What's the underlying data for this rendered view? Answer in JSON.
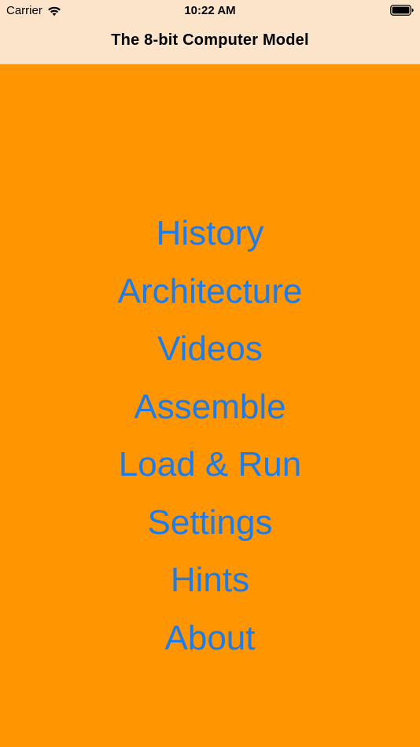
{
  "status_bar": {
    "carrier": "Carrier",
    "time": "10:22 AM",
    "wifi_icon": "wifi-icon",
    "battery_icon": "battery-icon"
  },
  "nav": {
    "title": "The 8-bit Computer Model"
  },
  "menu": {
    "items": [
      {
        "label": "History"
      },
      {
        "label": "Architecture"
      },
      {
        "label": "Videos"
      },
      {
        "label": "Assemble"
      },
      {
        "label": "Load & Run"
      },
      {
        "label": "Settings"
      },
      {
        "label": "Hints"
      },
      {
        "label": "About"
      }
    ]
  },
  "colors": {
    "background": "#FF9500",
    "top_bar": "#FBE4C9",
    "link": "#1E7BE8"
  }
}
